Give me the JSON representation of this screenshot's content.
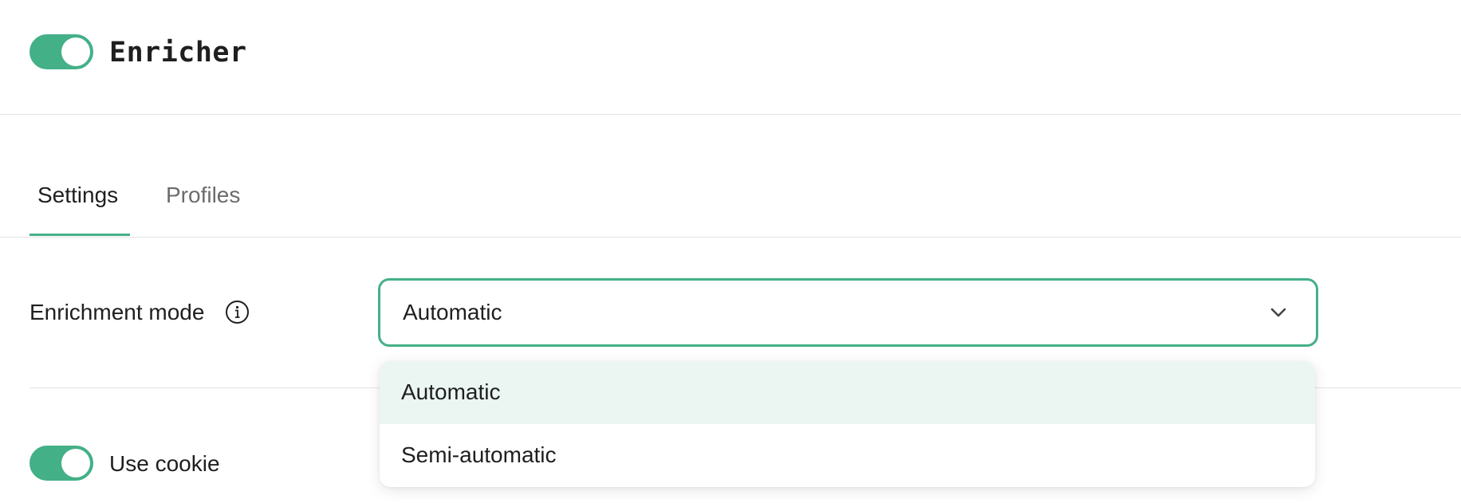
{
  "header": {
    "title": "Enricher",
    "enabled": true
  },
  "tabs": [
    {
      "label": "Settings",
      "active": true
    },
    {
      "label": "Profiles",
      "active": false
    }
  ],
  "enrichment_mode": {
    "label": "Enrichment mode",
    "info_icon": "info-icon",
    "selected": "Automatic",
    "chevron_icon": "chevron-down-icon",
    "options": [
      "Automatic",
      "Semi-automatic"
    ]
  },
  "use_cookie": {
    "label": "Use cookie",
    "enabled": true
  },
  "colors": {
    "accent": "#44b088",
    "selected_option_bg": "#ebf6f2",
    "divider": "#e3e3e3"
  }
}
